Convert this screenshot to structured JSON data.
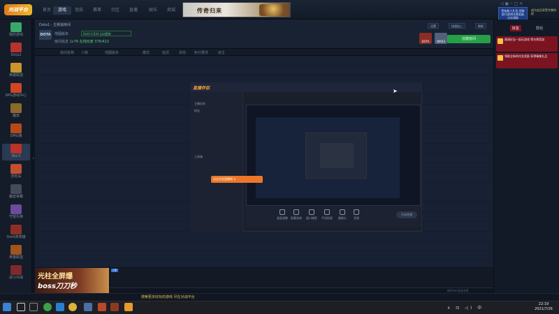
{
  "app": {
    "logo_text": "对战平台",
    "nav_tabs": [
      "首页",
      "游戏",
      "竞技",
      "赛事",
      "社区",
      "直播",
      "娱乐",
      "商城"
    ],
    "active_tab_index": 1,
    "banner_text": "传奇归来",
    "window_controls": "◁ ▣ ─ □ ✕"
  },
  "promos": {
    "left": "您有新人礼包 领取即可获得丰厚奖励 点击领取",
    "right": "成为会员享受专属特权"
  },
  "sidebar": {
    "games": [
      {
        "label": "我的游戏",
        "color": "#3aa86b"
      },
      {
        "label": "Dota2",
        "color": "#b8332b"
      },
      {
        "label": "英雄联盟",
        "color": "#c9962d"
      },
      {
        "label": "RPG游戏中心",
        "color": "#d04525"
      },
      {
        "label": "魔兽",
        "color": "#8a6a2a"
      },
      {
        "label": "DMG服",
        "color": "#b74919"
      },
      {
        "label": "War3",
        "color": "#b8332b"
      },
      {
        "label": "冒险岛",
        "color": "#c24f2e"
      },
      {
        "label": "魔兽争霸",
        "color": "#444b57"
      },
      {
        "label": "守望先锋",
        "color": "#6b4b9c"
      },
      {
        "label": "DotA真英雄",
        "color": "#8c2f25"
      },
      {
        "label": "英雄联盟",
        "color": "#a1551e"
      },
      {
        "label": "战斗对战",
        "color": "#7f2a2a"
      }
    ],
    "active_index": 6
  },
  "room": {
    "path": "Dota1 - 主频道房间",
    "game_badge": "DOTA",
    "map_label": "地图版本",
    "map_value": "DotA 6.83d 自动更新",
    "info_label": "房间信息",
    "info_value": "1v76",
    "info_extra": "在线玩家 376/422",
    "top_buttons": [
      "设置",
      "快速加入",
      "刷新"
    ],
    "create_room": "创建房间",
    "mini_logos": [
      "DOTA",
      "WAR3"
    ]
  },
  "table": {
    "headers": [
      "房间名称",
      "人数",
      "地图版本",
      "模式",
      "延迟",
      "状态",
      "积分要求",
      "房主"
    ]
  },
  "stream": {
    "logo": "直播伴侣",
    "tip": "点击开启直播吧 ✕",
    "toolbar": [
      "画面调整",
      "屏幕录制",
      "窗口捕获",
      "手机投屏",
      "摄像头",
      "音频"
    ],
    "start_label": "开始直播",
    "side_items": [
      "主播信息",
      "粉丝",
      "工具箱"
    ]
  },
  "bottom_banner": {
    "line1": "光柱全屏爆",
    "line2": "boss刀刀秒"
  },
  "chat": {
    "tag": "公告",
    "hint": "按Enter发送消息"
  },
  "right_panel": {
    "tabs": [
      "好友",
      "群组"
    ],
    "cards": [
      "邀请好友一起玩游戏 得丰厚奖励",
      "领取全新的任务奖励 获得精美礼品"
    ],
    "card_colors": [
      "#7b1420",
      "#7b1420"
    ]
  },
  "status": {
    "message": "搜索更多好玩的游戏 尽在对战平台"
  },
  "taskbar": {
    "time": "22:19",
    "date": "2021/7/26",
    "tray": "∧ ⊡ ◁) 中"
  }
}
